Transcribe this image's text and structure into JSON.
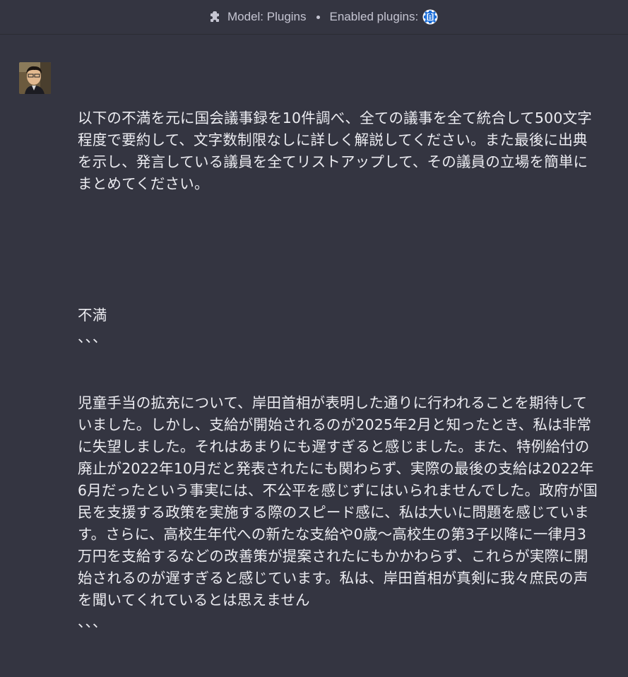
{
  "header": {
    "plugin_icon": "puzzle-piece-icon",
    "model_label": "Model: Plugins",
    "enabled_label": "Enabled plugins:",
    "enabled_plugins": [
      {
        "icon": "kokkai-plugin-icon",
        "accent": "#1e6fd9"
      }
    ]
  },
  "message": {
    "role": "user",
    "avatar": "user-avatar-photo",
    "paragraphs": [
      "以下の不満を元に国会議事録を10件調べ、全ての議事を全て統合して500文字程度で要約して、文字数制限なしに詳しく解説してください。また最後に出典を示し、発言している議員を全てリストアップして、その議員の立場を簡単にまとめてください。",
      "",
      "不満\n、、、",
      "児童手当の拡充について、岸田首相が表明した通りに行われることを期待していました。しかし、支給が開始されるのが2025年2月と知ったとき、私は非常に失望しました。それはあまりにも遅すぎると感じました。また、特例給付の廃止が2022年10月だと発表されたにも関わらず、実際の最後の支給は2022年6月だったという事実には、不公平を感じずにはいられませんでした。政府が国民を支援する政策を実施する際のスピード感に、私は大いに問題を感じています。さらに、高校生年代への新たな支給や0歳〜高校生の第3子以降に一律月3万円を支給するなどの改善策が提案されたにもかかわらず、これらが実際に開始されるのが遅すぎると感じています。私は、岸田首相が真剣に我々庶民の声を聞いてくれているとは思えません\n、、、"
    ]
  },
  "colors": {
    "background": "#343541",
    "text": "#ececf1",
    "header_text": "#c5c5d2"
  }
}
